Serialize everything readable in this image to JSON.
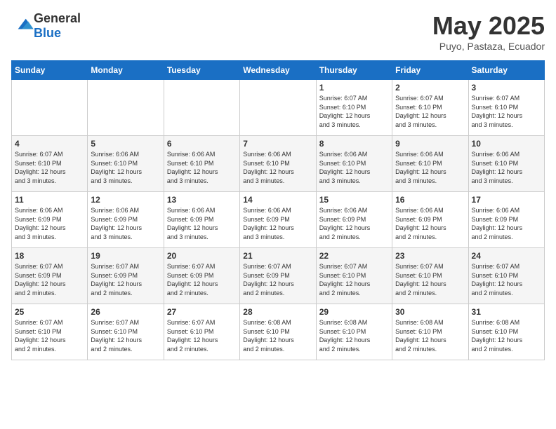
{
  "header": {
    "logo_general": "General",
    "logo_blue": "Blue",
    "month": "May 2025",
    "location": "Puyo, Pastaza, Ecuador"
  },
  "days_of_week": [
    "Sunday",
    "Monday",
    "Tuesday",
    "Wednesday",
    "Thursday",
    "Friday",
    "Saturday"
  ],
  "weeks": [
    [
      {
        "num": "",
        "info": ""
      },
      {
        "num": "",
        "info": ""
      },
      {
        "num": "",
        "info": ""
      },
      {
        "num": "",
        "info": ""
      },
      {
        "num": "1",
        "info": "Sunrise: 6:07 AM\nSunset: 6:10 PM\nDaylight: 12 hours\nand 3 minutes."
      },
      {
        "num": "2",
        "info": "Sunrise: 6:07 AM\nSunset: 6:10 PM\nDaylight: 12 hours\nand 3 minutes."
      },
      {
        "num": "3",
        "info": "Sunrise: 6:07 AM\nSunset: 6:10 PM\nDaylight: 12 hours\nand 3 minutes."
      }
    ],
    [
      {
        "num": "4",
        "info": "Sunrise: 6:07 AM\nSunset: 6:10 PM\nDaylight: 12 hours\nand 3 minutes."
      },
      {
        "num": "5",
        "info": "Sunrise: 6:06 AM\nSunset: 6:10 PM\nDaylight: 12 hours\nand 3 minutes."
      },
      {
        "num": "6",
        "info": "Sunrise: 6:06 AM\nSunset: 6:10 PM\nDaylight: 12 hours\nand 3 minutes."
      },
      {
        "num": "7",
        "info": "Sunrise: 6:06 AM\nSunset: 6:10 PM\nDaylight: 12 hours\nand 3 minutes."
      },
      {
        "num": "8",
        "info": "Sunrise: 6:06 AM\nSunset: 6:10 PM\nDaylight: 12 hours\nand 3 minutes."
      },
      {
        "num": "9",
        "info": "Sunrise: 6:06 AM\nSunset: 6:10 PM\nDaylight: 12 hours\nand 3 minutes."
      },
      {
        "num": "10",
        "info": "Sunrise: 6:06 AM\nSunset: 6:10 PM\nDaylight: 12 hours\nand 3 minutes."
      }
    ],
    [
      {
        "num": "11",
        "info": "Sunrise: 6:06 AM\nSunset: 6:09 PM\nDaylight: 12 hours\nand 3 minutes."
      },
      {
        "num": "12",
        "info": "Sunrise: 6:06 AM\nSunset: 6:09 PM\nDaylight: 12 hours\nand 3 minutes."
      },
      {
        "num": "13",
        "info": "Sunrise: 6:06 AM\nSunset: 6:09 PM\nDaylight: 12 hours\nand 3 minutes."
      },
      {
        "num": "14",
        "info": "Sunrise: 6:06 AM\nSunset: 6:09 PM\nDaylight: 12 hours\nand 3 minutes."
      },
      {
        "num": "15",
        "info": "Sunrise: 6:06 AM\nSunset: 6:09 PM\nDaylight: 12 hours\nand 2 minutes."
      },
      {
        "num": "16",
        "info": "Sunrise: 6:06 AM\nSunset: 6:09 PM\nDaylight: 12 hours\nand 2 minutes."
      },
      {
        "num": "17",
        "info": "Sunrise: 6:06 AM\nSunset: 6:09 PM\nDaylight: 12 hours\nand 2 minutes."
      }
    ],
    [
      {
        "num": "18",
        "info": "Sunrise: 6:07 AM\nSunset: 6:09 PM\nDaylight: 12 hours\nand 2 minutes."
      },
      {
        "num": "19",
        "info": "Sunrise: 6:07 AM\nSunset: 6:09 PM\nDaylight: 12 hours\nand 2 minutes."
      },
      {
        "num": "20",
        "info": "Sunrise: 6:07 AM\nSunset: 6:09 PM\nDaylight: 12 hours\nand 2 minutes."
      },
      {
        "num": "21",
        "info": "Sunrise: 6:07 AM\nSunset: 6:09 PM\nDaylight: 12 hours\nand 2 minutes."
      },
      {
        "num": "22",
        "info": "Sunrise: 6:07 AM\nSunset: 6:10 PM\nDaylight: 12 hours\nand 2 minutes."
      },
      {
        "num": "23",
        "info": "Sunrise: 6:07 AM\nSunset: 6:10 PM\nDaylight: 12 hours\nand 2 minutes."
      },
      {
        "num": "24",
        "info": "Sunrise: 6:07 AM\nSunset: 6:10 PM\nDaylight: 12 hours\nand 2 minutes."
      }
    ],
    [
      {
        "num": "25",
        "info": "Sunrise: 6:07 AM\nSunset: 6:10 PM\nDaylight: 12 hours\nand 2 minutes."
      },
      {
        "num": "26",
        "info": "Sunrise: 6:07 AM\nSunset: 6:10 PM\nDaylight: 12 hours\nand 2 minutes."
      },
      {
        "num": "27",
        "info": "Sunrise: 6:07 AM\nSunset: 6:10 PM\nDaylight: 12 hours\nand 2 minutes."
      },
      {
        "num": "28",
        "info": "Sunrise: 6:08 AM\nSunset: 6:10 PM\nDaylight: 12 hours\nand 2 minutes."
      },
      {
        "num": "29",
        "info": "Sunrise: 6:08 AM\nSunset: 6:10 PM\nDaylight: 12 hours\nand 2 minutes."
      },
      {
        "num": "30",
        "info": "Sunrise: 6:08 AM\nSunset: 6:10 PM\nDaylight: 12 hours\nand 2 minutes."
      },
      {
        "num": "31",
        "info": "Sunrise: 6:08 AM\nSunset: 6:10 PM\nDaylight: 12 hours\nand 2 minutes."
      }
    ]
  ]
}
